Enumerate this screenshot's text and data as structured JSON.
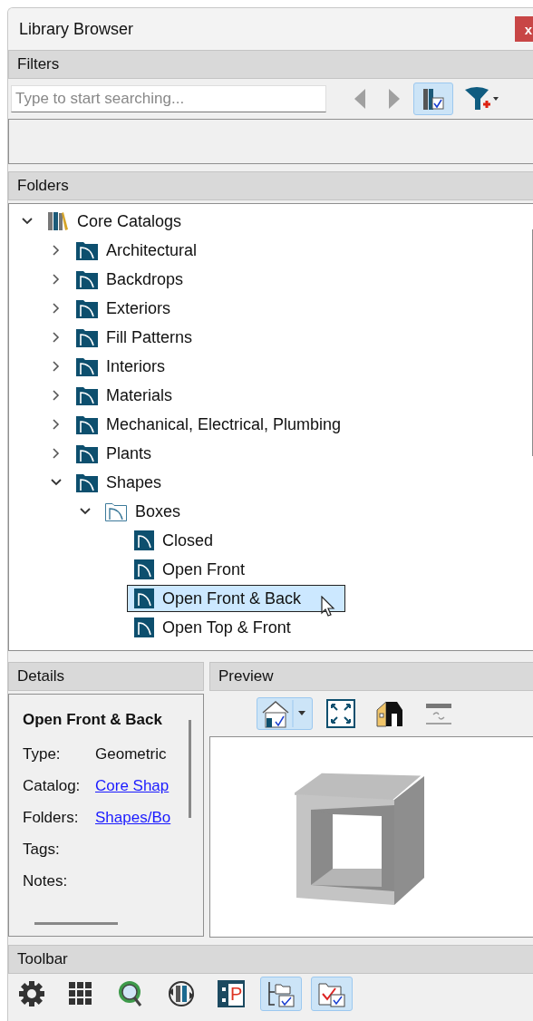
{
  "window": {
    "title": "Library Browser",
    "close": "x"
  },
  "filters": {
    "header": "Filters",
    "search": {
      "placeholder": "Type to start searching..."
    },
    "tools": [
      {
        "kind": "back",
        "on": false
      },
      {
        "kind": "forward",
        "on": false
      },
      {
        "kind": "library",
        "on": true
      },
      {
        "kind": "filter",
        "on": false
      }
    ]
  },
  "folders": {
    "header": "Folders",
    "tree": [
      {
        "label": "Core Catalogs",
        "kind": "catalog",
        "expanded": true,
        "selected": false,
        "children": [
          {
            "label": "Architectural",
            "kind": "folder",
            "expanded": false,
            "selected": false
          },
          {
            "label": "Backdrops",
            "kind": "folder",
            "expanded": false,
            "selected": false
          },
          {
            "label": "Exteriors",
            "kind": "folder",
            "expanded": false,
            "selected": false
          },
          {
            "label": "Fill Patterns",
            "kind": "folder",
            "expanded": false,
            "selected": false
          },
          {
            "label": "Interiors",
            "kind": "folder",
            "expanded": false,
            "selected": false
          },
          {
            "label": "Materials",
            "kind": "folder",
            "expanded": false,
            "selected": false
          },
          {
            "label": "Mechanical, Electrical, Plumbing",
            "kind": "folder",
            "expanded": false,
            "selected": false
          },
          {
            "label": "Plants",
            "kind": "folder",
            "expanded": false,
            "selected": false
          },
          {
            "label": "Shapes",
            "kind": "folder",
            "expanded": true,
            "selected": false,
            "children": [
              {
                "label": "Boxes",
                "kind": "subfolder",
                "expanded": true,
                "selected": false,
                "children": [
                  {
                    "label": "Closed",
                    "kind": "item",
                    "selected": false
                  },
                  {
                    "label": "Open Front",
                    "kind": "item",
                    "selected": false
                  },
                  {
                    "label": "Open Front & Back",
                    "kind": "item",
                    "selected": true
                  },
                  {
                    "label": "Open Top & Front",
                    "kind": "item",
                    "selected": false
                  }
                ]
              }
            ]
          }
        ]
      }
    ]
  },
  "details": {
    "header": "Details",
    "title": "Open Front & Back",
    "fields": [
      {
        "label": "Type:",
        "value": "Geometric",
        "kind": "text"
      },
      {
        "label": "Catalog:",
        "value": "Core Shap",
        "kind": "link"
      },
      {
        "label": "Folders:",
        "value": "Shapes/Bo",
        "kind": "link"
      },
      {
        "label": "Tags:"
      },
      {
        "label": "Notes:"
      }
    ]
  },
  "preview": {
    "header": "Preview",
    "tools": [
      {
        "kind": "view",
        "on": true
      },
      {
        "kind": "fit",
        "on": false
      },
      {
        "kind": "house",
        "on": false
      },
      {
        "kind": "swap",
        "on": false
      }
    ]
  },
  "toolbar": {
    "header": "Toolbar",
    "p_letter": "P",
    "tools": [
      {
        "kind": "gear",
        "on": false
      },
      {
        "kind": "grid",
        "on": false
      },
      {
        "kind": "search",
        "on": false
      },
      {
        "kind": "sync",
        "on": false
      },
      {
        "kind": "panel",
        "on": false
      },
      {
        "kind": "tree",
        "on": true
      },
      {
        "kind": "folder-check",
        "on": true
      }
    ]
  }
}
